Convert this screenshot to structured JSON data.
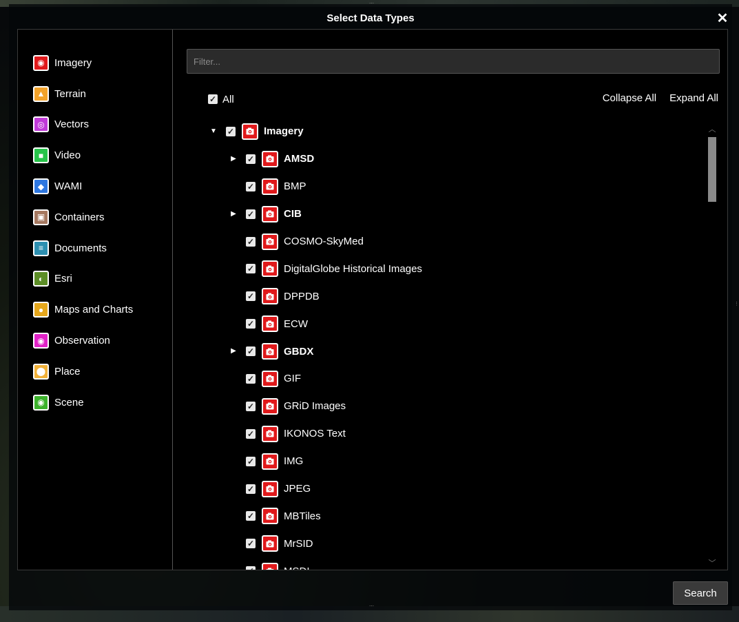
{
  "dialog": {
    "title": "Select Data Types",
    "close_symbol": "✕"
  },
  "categories": [
    {
      "label": "Imagery",
      "icon": "camera-icon",
      "color": "#e0191b",
      "glyph": "◉"
    },
    {
      "label": "Terrain",
      "icon": "terrain-icon",
      "color": "#f2a22a",
      "glyph": "▲"
    },
    {
      "label": "Vectors",
      "icon": "vector-icon",
      "color": "#c03ad8",
      "glyph": "◎"
    },
    {
      "label": "Video",
      "icon": "video-icon",
      "color": "#27c44a",
      "glyph": "■"
    },
    {
      "label": "WAMI",
      "icon": "layers-icon",
      "color": "#2e77e0",
      "glyph": "◆"
    },
    {
      "label": "Containers",
      "icon": "box-icon",
      "color": "#a57860",
      "glyph": "▣"
    },
    {
      "label": "Documents",
      "icon": "document-icon",
      "color": "#2d8fb0",
      "glyph": "≡"
    },
    {
      "label": "Esri",
      "icon": "esri-icon",
      "color": "#5c8d26",
      "glyph": "◐"
    },
    {
      "label": "Maps and Charts",
      "icon": "globe-icon",
      "color": "#e4a61c",
      "glyph": "●"
    },
    {
      "label": "Observation",
      "icon": "eye-icon",
      "color": "#e022c6",
      "glyph": "◉"
    },
    {
      "label": "Place",
      "icon": "pin-icon",
      "color": "#f2b23a",
      "glyph": "⬤"
    },
    {
      "label": "Scene",
      "icon": "scene-icon",
      "color": "#3db22c",
      "glyph": "◉"
    }
  ],
  "filter": {
    "placeholder": "Filter...",
    "value": ""
  },
  "all": {
    "label": "All",
    "checked": true
  },
  "actions": {
    "collapse_all": "Collapse All",
    "expand_all": "Expand All"
  },
  "tree": [
    {
      "label": "Imagery",
      "level": 0,
      "expander": "down",
      "bold": true,
      "checked": true
    },
    {
      "label": "AMSD",
      "level": 1,
      "expander": "right",
      "bold": true,
      "checked": true
    },
    {
      "label": "BMP",
      "level": 1,
      "expander": "none",
      "bold": false,
      "checked": true
    },
    {
      "label": "CIB",
      "level": 1,
      "expander": "right",
      "bold": true,
      "checked": true
    },
    {
      "label": "COSMO-SkyMed",
      "level": 1,
      "expander": "none",
      "bold": false,
      "checked": true
    },
    {
      "label": "DigitalGlobe Historical Images",
      "level": 1,
      "expander": "none",
      "bold": false,
      "checked": true
    },
    {
      "label": "DPPDB",
      "level": 1,
      "expander": "none",
      "bold": false,
      "checked": true
    },
    {
      "label": "ECW",
      "level": 1,
      "expander": "none",
      "bold": false,
      "checked": true
    },
    {
      "label": "GBDX",
      "level": 1,
      "expander": "right",
      "bold": true,
      "checked": true
    },
    {
      "label": "GIF",
      "level": 1,
      "expander": "none",
      "bold": false,
      "checked": true
    },
    {
      "label": "GRiD Images",
      "level": 1,
      "expander": "none",
      "bold": false,
      "checked": true
    },
    {
      "label": "IKONOS Text",
      "level": 1,
      "expander": "none",
      "bold": false,
      "checked": true
    },
    {
      "label": "IMG",
      "level": 1,
      "expander": "none",
      "bold": false,
      "checked": true
    },
    {
      "label": "JPEG",
      "level": 1,
      "expander": "none",
      "bold": false,
      "checked": true
    },
    {
      "label": "MBTiles",
      "level": 1,
      "expander": "none",
      "bold": false,
      "checked": true
    },
    {
      "label": "MrSID",
      "level": 1,
      "expander": "none",
      "bold": false,
      "checked": true
    },
    {
      "label": "MSDI",
      "level": 1,
      "expander": "none",
      "bold": false,
      "checked": true
    }
  ],
  "search": {
    "label": "Search"
  }
}
